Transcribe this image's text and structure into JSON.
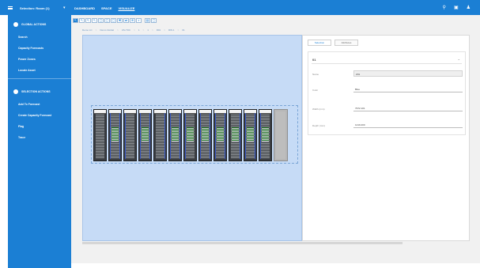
{
  "topbar": {
    "selection_label": "Selection: Room (1)",
    "nav": [
      "DASHBOARD",
      "SPACE",
      "VISUALIZE"
    ],
    "active_nav": "VISUALIZE"
  },
  "sidebar": {
    "global_title": "GLOBAL ACTIONS",
    "global_items": [
      "Search",
      "Capacity Forecasts",
      "Power Zones",
      "Locate Asset"
    ],
    "selection_title": "SELECTION ACTIONS",
    "selection_items": [
      "Add To Forecast",
      "Create Capacity Forecast",
      "Flag",
      "Trace"
    ]
  },
  "toolbar": {
    "tools": [
      "↖",
      "↖",
      "↖",
      "↖",
      "▢",
      "▢",
      "▢",
      "✖",
      "⇄",
      "⊕",
      "⌕",
      "▤",
      "▢"
    ]
  },
  "breadcrumb": [
    "Demo LC",
    "Demo Global",
    "US-TDC",
    "1",
    "1",
    "R01",
    "RW-1",
    "01"
  ],
  "panel": {
    "tabs": [
      "Selection",
      "Attributes"
    ],
    "active_tab": "Selection",
    "card_title": "01",
    "props": [
      {
        "label": "Name",
        "value": "Z01"
      },
      {
        "label": "Color",
        "value": "Blue"
      },
      {
        "label": "Width (mm)",
        "value": "7972.101"
      },
      {
        "label": "Depth (mm)",
        "value": "1219.200"
      }
    ]
  },
  "colors": {
    "brand": "#1b7fd4",
    "canvas": "#c6dbf6",
    "rack": "#3a3d42",
    "rack_highlight": "#2e7d32"
  }
}
